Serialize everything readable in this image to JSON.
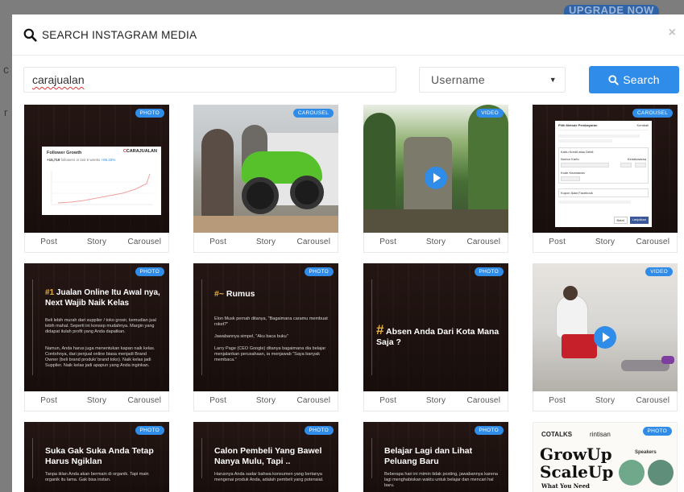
{
  "backdrop": {
    "upgrade_label": "UPGRADE NOW",
    "char1": "c",
    "char2": "r"
  },
  "modal": {
    "title": "SEARCH INSTAGRAM MEDIA",
    "close_symbol": "×",
    "search_value": "carajualan",
    "filter_selected": "Username",
    "search_button": "Search"
  },
  "media": [
    {
      "badge": "PHOTO",
      "type": "photo-chart",
      "chart_title": "Follower Growth",
      "chart_stat": "+15,719",
      "chart_stat_note": "followers in last 8 weeks",
      "chart_pct": "+85.33%",
      "logo_text": "CARAJUALAN",
      "actions": [
        "Post",
        "Story",
        "Carousel"
      ]
    },
    {
      "badge": "CAROUSEL",
      "type": "photo-moto",
      "actions": [
        "Post",
        "Story",
        "Carousel"
      ]
    },
    {
      "badge": "VIDEO",
      "type": "video-temple",
      "actions": [
        "Post",
        "Story",
        "Carousel"
      ]
    },
    {
      "badge": "CAROUSEL",
      "type": "screenshot",
      "form_title": "Pilih Metode Pembayaran",
      "form_back": "Kembali",
      "form_option": "Kartu Kredit atau Debit",
      "form_card": "Nomor Kartu",
      "form_expiry": "Kedaluwarsa",
      "form_code": "Kode Keamanan",
      "form_fb": "Kupon Iklan Facebook",
      "form_cancel": "Batal",
      "form_continue": "Lanjutkan",
      "actions": [
        "Post",
        "Story",
        "Carousel"
      ]
    },
    {
      "badge": "PHOTO",
      "type": "text",
      "title_hash": "#1",
      "title": "Jualan Online Itu Awal nya, Next Wajib Naik Kelas",
      "body": "Beli lebih murah dari supplier / toko grosir, kemudian jual lebih mahal. Seperti ini konsep mudahnya. Margin yang didapat itulah profit yang Anda dapatkan.",
      "body2": "Namun, Anda harus juga menentukan kapan naik kelas. Contohnya, dari penjual online biasa menjadi Brand Owner (beli brand produk/ brand toko). Naik kelas jadi Supplier. Naik kelas jadi apapun yang Anda inginkan.",
      "actions": [
        "Post",
        "Story",
        "Carousel"
      ]
    },
    {
      "badge": "PHOTO",
      "type": "text",
      "title_hash": "#~",
      "title": "Rumus",
      "body": "Elon Musk pernah ditanya, \"Bagaimana caramu membuat roket?\"",
      "body2": "Jawabannya simpel, \"Aku baca buku\"",
      "body3": "Larry Page (CEO Google) ditanya bagaimana dia belajar menjalankan perusahaan, ia menjawab \"Saya banyak membaca.\"",
      "actions": [
        "Post",
        "Story",
        "Carousel"
      ]
    },
    {
      "badge": "PHOTO",
      "type": "text-center",
      "title_hash": "#",
      "title": "Absen Anda Dari Kota Mana Saja ?",
      "actions": [
        "Post",
        "Story",
        "Carousel"
      ]
    },
    {
      "badge": "VIDEO",
      "type": "video-street",
      "actions": [
        "Post",
        "Story",
        "Carousel"
      ]
    },
    {
      "badge": "PHOTO",
      "type": "text",
      "title": "Suka Gak Suka Anda Tetap Harus Ngiklan",
      "body": "Tanpa iklan Anda akan bermain di organik. Tapi main organik itu lama. Gak bisa instan."
    },
    {
      "badge": "PHOTO",
      "type": "text",
      "title": "Calon Pembeli Yang Bawel Nanya Mulu, Tapi ..",
      "body": "Harusnya Anda sadar bahwa konsumen yang bertanya mengenai produk Anda, adalah pembeli yang potensial."
    },
    {
      "badge": "PHOTO",
      "type": "text",
      "title": "Belajar Lagi dan Lihat Peluang Baru",
      "body": "Beberapa hari ini mimin tidak posting, jawabannya karena lagi menghabiskan waktu untuk belajar dan mencari hal baru."
    },
    {
      "badge": "PHOTO",
      "type": "poster",
      "brand1": "COTALKS",
      "brand2": "rintisan",
      "headline1": "GrowUp",
      "headline2": "ScaleUp",
      "sub": "What You Need",
      "speakers": "Speakers"
    }
  ]
}
